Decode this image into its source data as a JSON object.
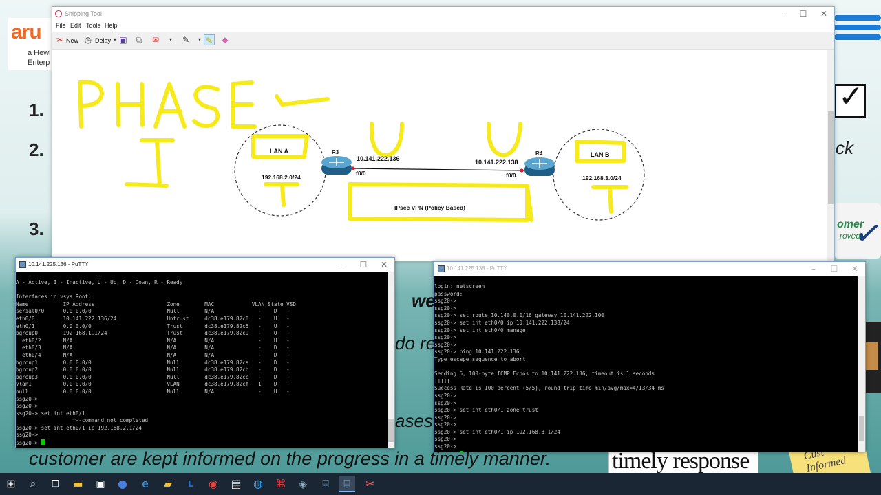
{
  "slide": {
    "logo_mark": "aru",
    "logo_sub": "a Hewl Enterp",
    "numbers": [
      "1.",
      "2.",
      "3."
    ],
    "right_ck": "ck",
    "badge_line1": "omer",
    "badge_line2": "roved",
    "mid_text_1": "wed",
    "mid_text_2": "do re",
    "mid_text_3": "ases",
    "bottom_text": "customer are kept informed on the progress in a timely manner.",
    "timely_response": "timely response",
    "sticky_text": "Cust Informed"
  },
  "snipping_tool": {
    "title": "Snipping Tool",
    "menu": [
      "File",
      "Edit",
      "Tools",
      "Help"
    ],
    "toolbar": {
      "new": "New",
      "delay": "Delay"
    },
    "diagram": {
      "handwriting_main": "PHASE -",
      "handwriting_numeral": "I",
      "lan_a": "LAN A",
      "lan_a_subnet": "192.168.2.0/24",
      "lan_b": "LAN B",
      "lan_b_subnet": "192.168.3.0/24",
      "router_left": "R3",
      "router_right": "R4",
      "ip_left": "10.141.222.136",
      "ip_right": "10.141.222.138",
      "iface_left": "f0/0",
      "iface_right": "f0/0",
      "vpn_label": "IPsec VPN (Policy Based)",
      "colors": {
        "highlight": "#f7ea1a",
        "router": "#2e7da6",
        "link_dot": "#e0202a"
      }
    }
  },
  "putty_left": {
    "title": "10.141.225.136 - PuTTY",
    "lines": [
      "A - Active, I - Inactive, U - Up, D - Down, R - Ready",
      "",
      "Interfaces in vsys Root:",
      "Name           IP Address                       Zone        MAC            VLAN State VSD",
      "serial0/0      0.0.0.0/0                        Null        N/A              -    D   -",
      "eth0/0         10.141.222.136/24                Untrust     dc38.e179.82c0   -    U   -",
      "eth0/1         0.0.0.0/0                        Trust       dc38.e179.82c5   -    U   -",
      "bgroup0        192.168.1.1/24                   Trust       dc38.e179.82c9   -    U   -",
      "  eth0/2       N/A                              N/A         N/A              -    U   -",
      "  eth0/3       N/A                              N/A         N/A              -    D   -",
      "  eth0/4       N/A                              N/A         N/A              -    D   -",
      "bgroup1        0.0.0.0/0                        Null        dc38.e179.82ca   -    D   -",
      "bgroup2        0.0.0.0/0                        Null        dc38.e179.82cb   -    D   -",
      "bgroup3        0.0.0.0/0                        Null        dc38.e179.82cc   -    D   -",
      "vlan1          0.0.0.0/0                        VLAN        dc38.e179.82cf   1    D   -",
      "null           0.0.0.0/0                        Null        N/A              -    U   -",
      "ssg20->",
      "ssg20->",
      "ssg20-> set int eth0/1",
      "                  ^--command not completed",
      "ssg20-> set int eth0/1 ip 192.168.2.1/24",
      "ssg20->"
    ],
    "prompt": "ssg20-> "
  },
  "putty_right": {
    "title": "10.141.225.138 - PuTTY",
    "lines": [
      "login: netscreen",
      "password:",
      "ssg20->",
      "ssg20->",
      "ssg20-> set route 10.140.0.0/16 gateway 10.141.222.100",
      "ssg20-> set int eth0/0 ip 10.141.222.138/24",
      "ssg20-> set int eth0/0 manage",
      "ssg20->",
      "ssg20->",
      "ssg20-> ping 10.141.222.136",
      "Type escape sequence to abort",
      "",
      "Sending 5, 100-byte ICMP Echos to 10.141.222.136, timeout is 1 seconds",
      "!!!!!",
      "Success Rate is 100 percent (5/5), round-trip time min/avg/max=4/13/34 ms",
      "ssg20->",
      "ssg20->",
      "ssg20-> set int eth0/1 zone trust",
      "ssg20->",
      "ssg20->",
      "ssg20-> set int eth0/1 ip 192.168.3.1/24",
      "ssg20->",
      "ssg20->"
    ],
    "prompt": "ssg20-> "
  },
  "taskbar": {
    "icons": [
      "windows-start-icon",
      "search-icon",
      "task-view-icon",
      "file-explorer-icon",
      "store-icon",
      "firefox-icon",
      "edge-icon",
      "folder-icon",
      "lync-icon",
      "chrome-icon",
      "notepad-icon",
      "webex-icon",
      "acrobat-icon",
      "virtualbox-icon",
      "putty-icon",
      "putty-icon-active",
      "snipping-tool-icon"
    ]
  }
}
